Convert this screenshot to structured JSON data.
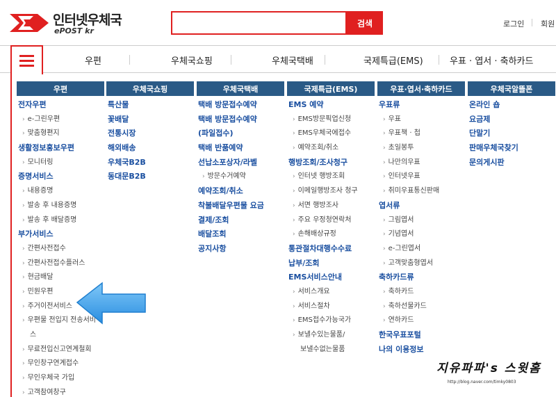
{
  "brand": {
    "name": "인터넷우체국",
    "sub": "ePOST kr",
    "color": "#e02020"
  },
  "search": {
    "value": "",
    "placeholder": "",
    "button": "검색"
  },
  "util": {
    "login": "로그인",
    "member": "회원"
  },
  "nav": [
    "우편",
    "우체국쇼핑",
    "우체국택배",
    "국제특급(EMS)",
    "우표 · 엽서 · 축하카드"
  ],
  "menu": {
    "header_color": "#2a5a86",
    "columns": [
      {
        "title": "우편",
        "items": [
          {
            "type": "cat",
            "text": "전자우편"
          },
          {
            "type": "sub",
            "text": "e-그린우편"
          },
          {
            "type": "sub",
            "text": "맞춤형편지"
          },
          {
            "type": "cat",
            "text": "생활정보홍보우편"
          },
          {
            "type": "sub",
            "text": "모니터링"
          },
          {
            "type": "cat",
            "text": "증명서비스"
          },
          {
            "type": "sub",
            "text": "내용증명"
          },
          {
            "type": "sub",
            "text": "발송 후 내용증명"
          },
          {
            "type": "sub",
            "text": "발송 후 배달증명"
          },
          {
            "type": "cat",
            "text": "부가서비스"
          },
          {
            "type": "sub",
            "text": "간편사전접수"
          },
          {
            "type": "sub",
            "text": "간편사전접수플러스"
          },
          {
            "type": "sub",
            "text": "현금배달"
          },
          {
            "type": "sub",
            "text": "민원우편"
          },
          {
            "type": "sub",
            "text": "주거이전서비스"
          },
          {
            "type": "sub",
            "text": "우편물 전입지 전송서비"
          },
          {
            "type": "cont",
            "text": "스"
          },
          {
            "type": "sub",
            "text": "무료전입신고연계철회"
          },
          {
            "type": "sub",
            "text": "무인창구연계접수"
          },
          {
            "type": "sub",
            "text": "무인우체국 가입"
          },
          {
            "type": "sub",
            "text": "고객참여창구"
          }
        ]
      },
      {
        "title": "우체국쇼핑",
        "items": [
          {
            "type": "cat",
            "text": "특산물"
          },
          {
            "type": "cat",
            "text": "꽃배달"
          },
          {
            "type": "cat",
            "text": "전통시장"
          },
          {
            "type": "cat",
            "text": "해외배송"
          },
          {
            "type": "cat",
            "text": "우체국B2B"
          },
          {
            "type": "cat",
            "text": "동대문B2B"
          }
        ]
      },
      {
        "title": "우체국택배",
        "items": [
          {
            "type": "cat",
            "text": "택배 방문접수예약"
          },
          {
            "type": "cat",
            "text": "택배 방문접수예약"
          },
          {
            "type": "cat",
            "text": "(파일접수)"
          },
          {
            "type": "cat",
            "text": "택배 반품예약"
          },
          {
            "type": "cat",
            "text": "선납소포상자/라벨"
          },
          {
            "type": "sub",
            "text": "방문수거예약"
          },
          {
            "type": "cat",
            "text": "예약조회/취소"
          },
          {
            "type": "cat",
            "text": "착불배달우편물 요금"
          },
          {
            "type": "cat",
            "text": "결제/조회"
          },
          {
            "type": "cat",
            "text": "배달조회"
          },
          {
            "type": "cat",
            "text": "공지사항"
          }
        ]
      },
      {
        "title": "국제특급(EMS)",
        "items": [
          {
            "type": "cat",
            "text": "EMS 예약"
          },
          {
            "type": "sub",
            "text": "EMS방문픽업신청"
          },
          {
            "type": "sub",
            "text": "EMS우체국에접수"
          },
          {
            "type": "sub",
            "text": "예약조회/취소"
          },
          {
            "type": "cat",
            "text": "행방조회/조사청구"
          },
          {
            "type": "sub",
            "text": "인터넷 행방조회"
          },
          {
            "type": "sub",
            "text": "이메일행방조사 청구"
          },
          {
            "type": "sub",
            "text": "서면 행방조사"
          },
          {
            "type": "sub",
            "text": "주요 우정청연락처"
          },
          {
            "type": "sub",
            "text": "손해배상규정"
          },
          {
            "type": "cat",
            "text": "통관절차대행수수료"
          },
          {
            "type": "cat",
            "text": "납부/조회"
          },
          {
            "type": "cat",
            "text": "EMS서비스안내"
          },
          {
            "type": "sub",
            "text": "서비스개요"
          },
          {
            "type": "sub",
            "text": "서비스절차"
          },
          {
            "type": "sub",
            "text": "EMS접수가능국가"
          },
          {
            "type": "sub",
            "text": "보낼수있는물품/"
          },
          {
            "type": "cont",
            "text": "보낼수없는물품"
          }
        ]
      },
      {
        "title": "우표·엽서·축하카드",
        "items": [
          {
            "type": "cat",
            "text": "우표류"
          },
          {
            "type": "sub",
            "text": "우표"
          },
          {
            "type": "sub",
            "text": "우표책 · 첩"
          },
          {
            "type": "sub",
            "text": "초일봉투"
          },
          {
            "type": "sub",
            "text": "나만의우표"
          },
          {
            "type": "sub",
            "text": "인터넷우표"
          },
          {
            "type": "sub",
            "text": "취미우표통신판매"
          },
          {
            "type": "cat",
            "text": "엽서류"
          },
          {
            "type": "sub",
            "text": "그림엽서"
          },
          {
            "type": "sub",
            "text": "기념엽서"
          },
          {
            "type": "sub",
            "text": "e-그린엽서"
          },
          {
            "type": "sub",
            "text": "고객맞춤형엽서"
          },
          {
            "type": "cat",
            "text": "축하카드류"
          },
          {
            "type": "sub",
            "text": "축하카드"
          },
          {
            "type": "sub",
            "text": "축하선물카드"
          },
          {
            "type": "sub",
            "text": "연하카드"
          },
          {
            "type": "cat",
            "text": "한국우표포털"
          },
          {
            "type": "cat",
            "text": "나의 이용정보"
          }
        ]
      },
      {
        "title": "우체국알뜰폰",
        "items": [
          {
            "type": "cat",
            "text": "온라인 숍"
          },
          {
            "type": "cat",
            "text": "요금제"
          },
          {
            "type": "cat",
            "text": "단말기"
          },
          {
            "type": "cat",
            "text": "판매우체국찾기"
          },
          {
            "type": "cat",
            "text": "문의게시판"
          }
        ]
      }
    ]
  },
  "watermark": {
    "title": "지유파파's 스윗홈",
    "url": "http://blog.naver.com/timky0803"
  },
  "arrow_color": "#3da0e8"
}
